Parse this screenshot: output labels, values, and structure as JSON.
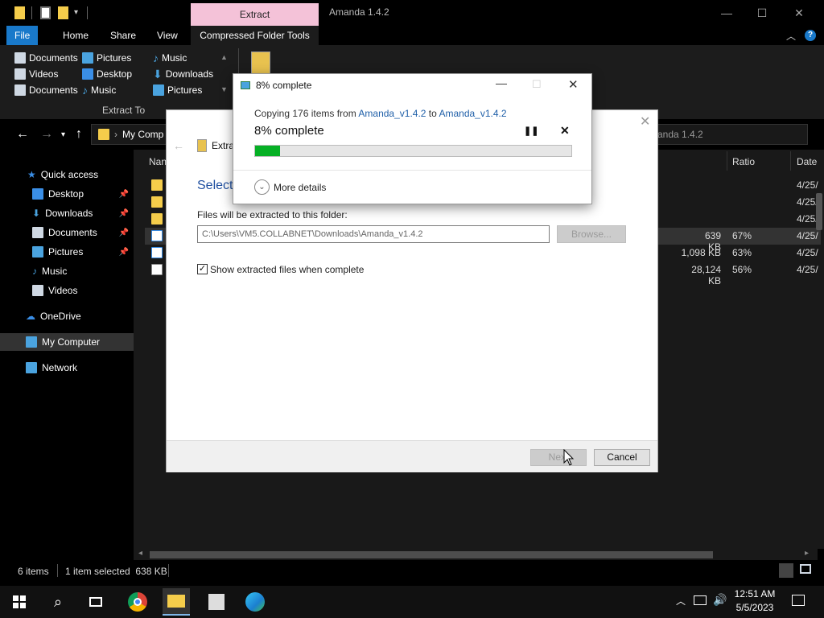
{
  "titlebar": {
    "context_tab": "Extract",
    "window_title": "Amanda 1.4.2",
    "min": "—",
    "max": "☐",
    "close": "✕"
  },
  "ribbon_tabs": [
    "File",
    "Home",
    "Share",
    "View",
    "Compressed Folder Tools"
  ],
  "ribbon": {
    "destinations": [
      "Documents",
      "Pictures",
      "Music",
      "Videos",
      "Desktop",
      "Downloads",
      "Documents",
      "Music",
      "Pictures"
    ],
    "group_label": "Extract To"
  },
  "address": {
    "crumb": "My Comp",
    "search_text": "anda 1.4.2"
  },
  "nav": {
    "quick_access": "Quick access",
    "items": [
      "Desktop",
      "Downloads",
      "Documents",
      "Pictures",
      "Music",
      "Videos"
    ],
    "onedrive": "OneDrive",
    "my_computer": "My Computer",
    "network": "Network"
  },
  "filelist": {
    "headers": {
      "name": "Nan",
      "ratio": "Ratio",
      "date": "Date"
    },
    "rows": [
      {
        "size": "",
        "ratio": "",
        "date": "4/25/"
      },
      {
        "size": "",
        "ratio": "",
        "date": "4/25/"
      },
      {
        "size": "",
        "ratio": "",
        "date": "4/25/"
      },
      {
        "size": "639 KB",
        "ratio": "67%",
        "date": "4/25/"
      },
      {
        "size": "1,098 KB",
        "ratio": "63%",
        "date": "4/25/"
      },
      {
        "size": "28,124 KB",
        "ratio": "56%",
        "date": "4/25/"
      }
    ]
  },
  "statusbar": {
    "items": "6 items",
    "selected": "1 item selected  638 KB"
  },
  "wizard": {
    "crumb": "Extra",
    "heading": "Select",
    "folder_label": "Files will be extracted to this folder:",
    "path": "C:\\Users\\VM5.COLLABNET\\Downloads\\Amanda_v1.4.2",
    "browse": "Browse...",
    "show_files": "Show extracted files when complete",
    "next": "Next",
    "cancel": "Cancel"
  },
  "progress": {
    "title": "8% complete",
    "copying_prefix": "Copying 176 items from ",
    "from": "Amanda_v1.4.2",
    "to_word": " to ",
    "to": "Amanda_v1.4.2",
    "percent_text": "8% complete",
    "fraction": 0.08,
    "more_details": "More details",
    "bar_color": "#06b025"
  },
  "taskbar": {
    "time": "12:51 AM",
    "date": "5/5/2023"
  },
  "colors": {
    "dark_bg": "#000000",
    "file_bg": "#191919",
    "context_tab": "#f4c2d8",
    "link": "#1f5fa8",
    "progress": "#06b025"
  }
}
